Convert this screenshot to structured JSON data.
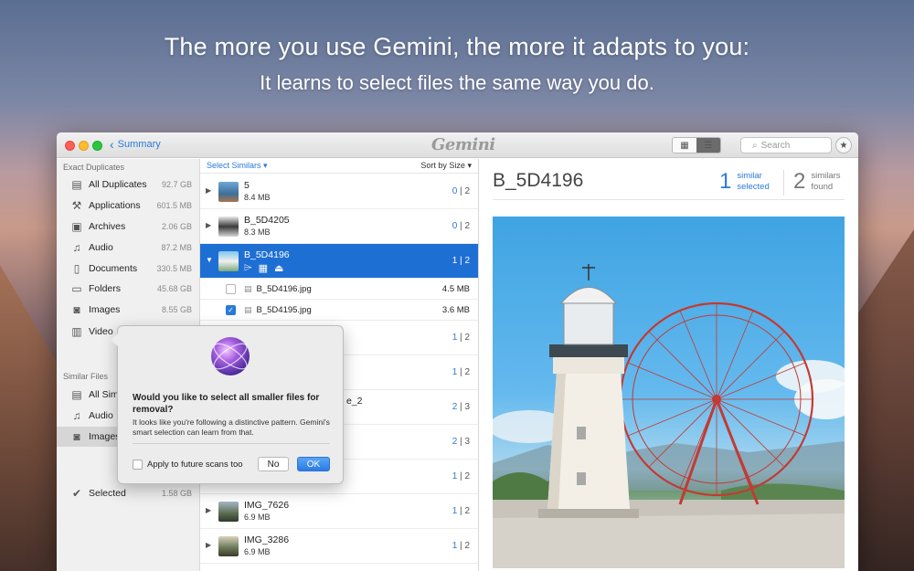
{
  "hero": {
    "headline": "The more you use Gemini, the more it adapts to you:",
    "subheadline": "It learns to select files the same way you do."
  },
  "titlebar": {
    "back_label": "Summary",
    "app_name": "Gemini",
    "search_placeholder": "Search"
  },
  "sidebar": {
    "exact_heading": "Exact Duplicates",
    "exact_items": [
      {
        "label": "All Duplicates",
        "size": "92.7 GB",
        "icon": "stack-icon"
      },
      {
        "label": "Applications",
        "size": "601.5 MB",
        "icon": "applications-icon"
      },
      {
        "label": "Archives",
        "size": "2.06 GB",
        "icon": "archive-icon"
      },
      {
        "label": "Audio",
        "size": "87.2 MB",
        "icon": "music-note-icon"
      },
      {
        "label": "Documents",
        "size": "330.5 MB",
        "icon": "document-icon"
      },
      {
        "label": "Folders",
        "size": "45.68 GB",
        "icon": "folder-icon"
      },
      {
        "label": "Images",
        "size": "8.55 GB",
        "icon": "camera-icon"
      },
      {
        "label": "Video",
        "size": "",
        "icon": "film-icon"
      }
    ],
    "similar_heading": "Similar Files",
    "similar_items": [
      {
        "label": "All Sim",
        "icon": "stack-icon"
      },
      {
        "label": "Audio",
        "icon": "music-note-icon"
      },
      {
        "label": "Images",
        "icon": "camera-icon"
      }
    ],
    "selected": {
      "label": "Selected",
      "size": "1.58 GB"
    }
  },
  "list": {
    "select_label": "Select Similars",
    "sort_label": "Sort by Size",
    "rows": [
      {
        "name": "5",
        "size": "8.4 MB",
        "selected": "0",
        "total": "2"
      },
      {
        "name": "B_5D4205",
        "size": "8.3 MB",
        "selected": "0",
        "total": "2"
      },
      {
        "name": "B_5D4196",
        "size": "",
        "selected": "1",
        "total": "2"
      }
    ],
    "files": [
      {
        "name": "B_5D4196.jpg",
        "size": "4.5 MB"
      },
      {
        "name": "B_5D4195.jpg",
        "size": "3.6 MB"
      }
    ],
    "partial_rows": [
      {
        "selected": "1",
        "total": "2"
      },
      {
        "selected": "1",
        "total": "2"
      },
      {
        "name_tail": "e_2",
        "selected": "2",
        "total": "3"
      },
      {
        "selected": "2",
        "total": "3"
      },
      {
        "selected": "1",
        "total": "2"
      }
    ],
    "bottom_rows": [
      {
        "name": "IMG_7626",
        "size": "6.9 MB",
        "selected": "1",
        "total": "2"
      },
      {
        "name": "IMG_3286",
        "size": "6.9 MB",
        "selected": "1",
        "total": "2"
      }
    ]
  },
  "detail": {
    "title": "B_5D4196",
    "similar_selected_count": "1",
    "similar_selected_label_1": "similar",
    "similar_selected_label_2": "selected",
    "similars_found_count": "2",
    "similars_found_label_1": "similars",
    "similars_found_label_2": "found"
  },
  "popover": {
    "title": "Would you like to select all smaller files for removal?",
    "body": "It looks like you're following a distinctive pattern. Gemini's smart selection can learn from that.",
    "checkbox_label": "Apply to future scans too",
    "no_label": "No",
    "ok_label": "OK"
  },
  "colors": {
    "accent": "#2a7ad9",
    "selection": "#1e6fd4"
  }
}
